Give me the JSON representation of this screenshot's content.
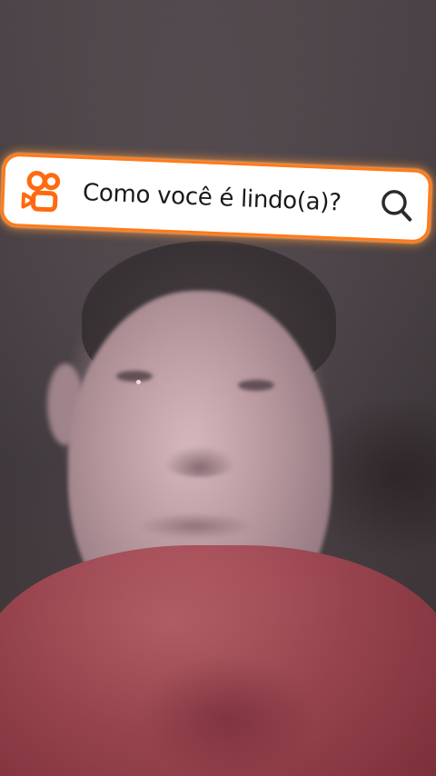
{
  "search": {
    "query": "Como você é lindo(a)?",
    "logo_icon": "kwai-camera-logo-icon",
    "search_icon": "magnifier-icon",
    "accent_color": "#ff7a1a"
  }
}
